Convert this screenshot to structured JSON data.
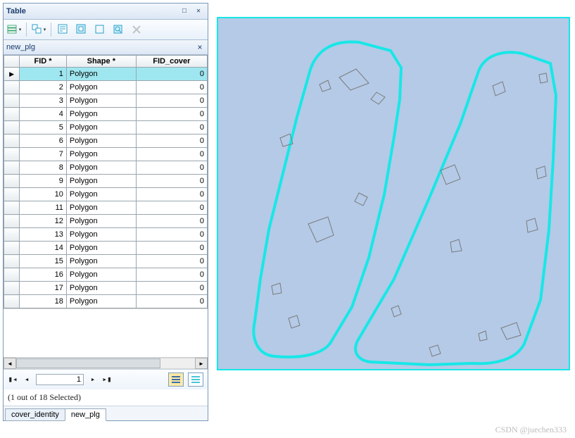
{
  "window": {
    "title": "Table",
    "tab_name": "new_plg"
  },
  "columns": {
    "fid": "FID *",
    "shape": "Shape *",
    "cover": "FID_cover"
  },
  "rows": [
    {
      "fid": 1,
      "shape": "Polygon",
      "cover": 0,
      "selected": true
    },
    {
      "fid": 2,
      "shape": "Polygon",
      "cover": 0
    },
    {
      "fid": 3,
      "shape": "Polygon",
      "cover": 0
    },
    {
      "fid": 4,
      "shape": "Polygon",
      "cover": 0
    },
    {
      "fid": 5,
      "shape": "Polygon",
      "cover": 0
    },
    {
      "fid": 6,
      "shape": "Polygon",
      "cover": 0
    },
    {
      "fid": 7,
      "shape": "Polygon",
      "cover": 0
    },
    {
      "fid": 8,
      "shape": "Polygon",
      "cover": 0
    },
    {
      "fid": 9,
      "shape": "Polygon",
      "cover": 0
    },
    {
      "fid": 10,
      "shape": "Polygon",
      "cover": 0
    },
    {
      "fid": 11,
      "shape": "Polygon",
      "cover": 0
    },
    {
      "fid": 12,
      "shape": "Polygon",
      "cover": 0
    },
    {
      "fid": 13,
      "shape": "Polygon",
      "cover": 0
    },
    {
      "fid": 14,
      "shape": "Polygon",
      "cover": 0
    },
    {
      "fid": 15,
      "shape": "Polygon",
      "cover": 0
    },
    {
      "fid": 16,
      "shape": "Polygon",
      "cover": 0
    },
    {
      "fid": 17,
      "shape": "Polygon",
      "cover": 0
    },
    {
      "fid": 18,
      "shape": "Polygon",
      "cover": 0
    }
  ],
  "nav": {
    "current_record": "1"
  },
  "status": "(1 out of 18 Selected)",
  "bottom_tabs": {
    "cover_identity": "cover_identity",
    "new_plg": "new_plg"
  },
  "watermark": "CSDN @juechen333"
}
